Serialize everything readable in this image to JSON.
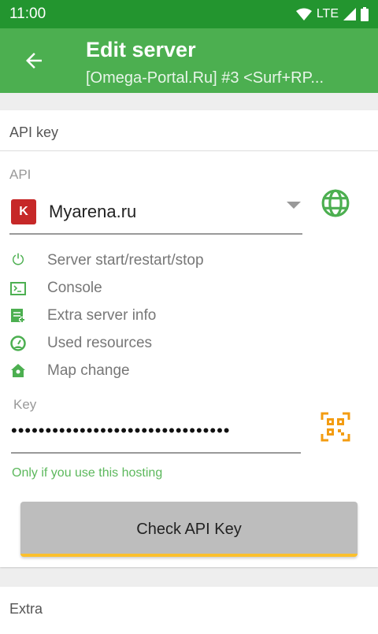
{
  "status_bar": {
    "time": "11:00",
    "network": "LTE"
  },
  "toolbar": {
    "title": "Edit server",
    "subtitle": "[Omega-Portal.Ru] #3 <Surf+RP..."
  },
  "api_card": {
    "header": "API key",
    "api_label": "API",
    "api_selected": "Myarena.ru",
    "features": [
      "Server start/restart/stop",
      "Console",
      "Extra server info",
      "Used resources",
      "Map change"
    ],
    "key_label": "Key",
    "key_value": "••••••••••••••••••••••••••••••••",
    "hint": "Only if you use this hosting",
    "check_button": "Check API Key"
  },
  "extra_card": {
    "header": "Extra"
  },
  "colors": {
    "primary": "#4caf50",
    "status_bar": "#23952f",
    "accent": "#fbc02d",
    "qr": "#f39c12"
  }
}
